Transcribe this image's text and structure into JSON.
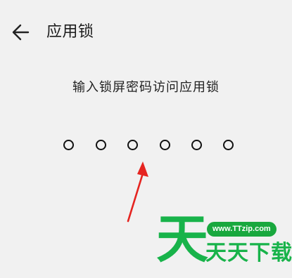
{
  "header": {
    "title": "应用锁",
    "back_icon": "arrow-left-icon"
  },
  "lock": {
    "prompt": "输入锁屏密码访问应用锁",
    "pin_length": 6,
    "digits_entered": 0
  },
  "annotation": {
    "type": "red-arrow",
    "color": "#e52420",
    "points_to": "pin-dot-3"
  },
  "watermark": {
    "big_char": "天",
    "url_badge": "www.TTzip.com",
    "chars": "天天下载",
    "color": "#18b34a"
  }
}
